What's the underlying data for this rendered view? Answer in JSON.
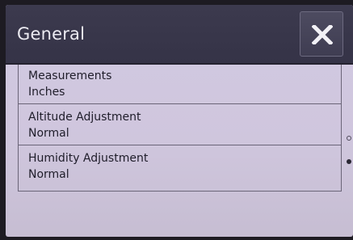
{
  "header": {
    "title": "General"
  },
  "close": {
    "icon": "close-icon"
  },
  "settings": [
    {
      "label": "Measurements",
      "value": "Inches"
    },
    {
      "label": "Altitude Adjustment",
      "value": "Normal"
    },
    {
      "label": "Humidity Adjustment",
      "value": "Normal"
    }
  ],
  "scroll_indicator": {
    "pages": 2,
    "current": 2
  }
}
